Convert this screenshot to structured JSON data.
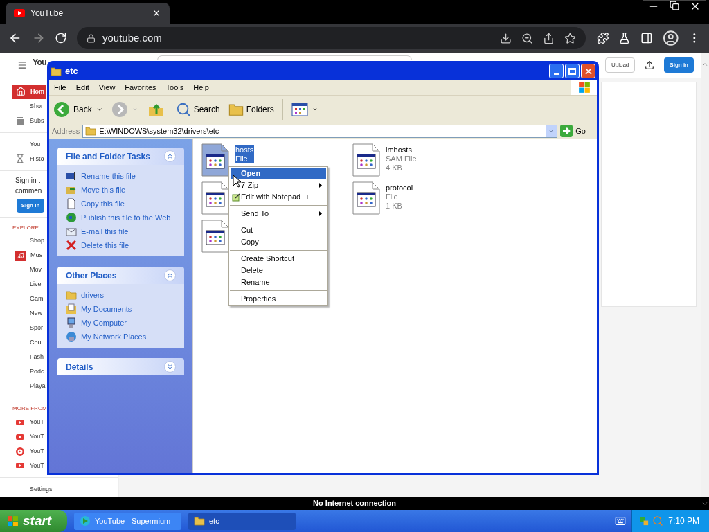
{
  "browser": {
    "tab": {
      "title": "YouTube"
    },
    "address": "youtube.com",
    "forward_disabled": true,
    "status": "No Internet connection"
  },
  "youtube": {
    "logo": "You",
    "upload": "Upload",
    "sign_in": "Sign in",
    "sidebar": [
      {
        "kind": "item",
        "label": "Hom",
        "selected": true
      },
      {
        "kind": "item",
        "label": "Shor",
        "selected": false
      },
      {
        "kind": "item",
        "label": "Subs",
        "selected": false
      },
      {
        "kind": "divider"
      },
      {
        "kind": "item",
        "label": "You",
        "selected": false
      },
      {
        "kind": "item",
        "label": "Histo",
        "selected": false
      },
      {
        "kind": "divider"
      },
      {
        "kind": "prompt",
        "text": "Sign in t\ncommen"
      },
      {
        "kind": "button",
        "label": "Sign in"
      },
      {
        "kind": "divider"
      },
      {
        "kind": "heading",
        "label": "EXPLORE"
      },
      {
        "kind": "item",
        "label": "Shop",
        "selected": false
      },
      {
        "kind": "item",
        "label": "Mus",
        "selected": false
      },
      {
        "kind": "item",
        "label": "Mov",
        "selected": false
      },
      {
        "kind": "item",
        "label": "Live",
        "selected": false
      },
      {
        "kind": "item",
        "label": "Gam",
        "selected": false
      },
      {
        "kind": "item",
        "label": "New",
        "selected": false
      },
      {
        "kind": "item",
        "label": "Spor",
        "selected": false
      },
      {
        "kind": "item",
        "label": "Cou",
        "selected": false
      },
      {
        "kind": "item",
        "label": "Fash",
        "selected": false
      },
      {
        "kind": "item",
        "label": "Podc",
        "selected": false
      },
      {
        "kind": "item",
        "label": "Playa",
        "selected": false
      },
      {
        "kind": "divider"
      },
      {
        "kind": "heading",
        "label": "MORE FROM"
      },
      {
        "kind": "item",
        "label": "YouT",
        "selected": false
      },
      {
        "kind": "item",
        "label": "YouT",
        "selected": false
      },
      {
        "kind": "item",
        "label": "YouT",
        "selected": false
      },
      {
        "kind": "item",
        "label": "YouT",
        "selected": false
      },
      {
        "kind": "divider"
      },
      {
        "kind": "item",
        "label": "Settings",
        "selected": false
      }
    ]
  },
  "explorer": {
    "title": "etc",
    "menu": [
      "File",
      "Edit",
      "View",
      "Favorites",
      "Tools",
      "Help"
    ],
    "toolbar": {
      "back": "Back",
      "search": "Search",
      "folders": "Folders",
      "forward_disabled": true
    },
    "address_label": "Address",
    "address": "E:\\WINDOWS\\system32\\drivers\\etc",
    "go": "Go",
    "panels": [
      {
        "title": "File and Folder Tasks",
        "expanded": true,
        "items": [
          "Rename this file",
          "Move this file",
          "Copy this file",
          "Publish this file to the Web",
          "E-mail this file",
          "Delete this file"
        ]
      },
      {
        "title": "Other Places",
        "expanded": true,
        "items": [
          "drivers",
          "My Documents",
          "My Computer",
          "My Network Places"
        ]
      },
      {
        "title": "Details",
        "expanded": false
      }
    ],
    "files": [
      {
        "name": "hosts",
        "type": "File",
        "selected": true
      },
      {
        "name": "lmhosts",
        "type": "SAM File",
        "size": "4 KB",
        "selected": false
      },
      {
        "selected": false
      },
      {
        "name": "protocol",
        "type": "File",
        "size": "1 KB",
        "selected": false
      },
      {
        "selected": false
      }
    ]
  },
  "context_menu": [
    {
      "kind": "item",
      "label": "Open",
      "default": true,
      "selected": true,
      "submenu": false
    },
    {
      "kind": "item",
      "label": "7-Zip",
      "default": false,
      "selected": false,
      "submenu": true
    },
    {
      "kind": "item",
      "label": "Edit with Notepad++",
      "default": false,
      "selected": false,
      "submenu": false
    },
    {
      "kind": "separator"
    },
    {
      "kind": "item",
      "label": "Send To",
      "default": false,
      "selected": false,
      "submenu": true
    },
    {
      "kind": "separator"
    },
    {
      "kind": "item",
      "label": "Cut",
      "default": false,
      "selected": false,
      "submenu": false
    },
    {
      "kind": "item",
      "label": "Copy",
      "default": false,
      "selected": false,
      "submenu": false
    },
    {
      "kind": "separator"
    },
    {
      "kind": "item",
      "label": "Create Shortcut",
      "default": false,
      "selected": false,
      "submenu": false
    },
    {
      "kind": "item",
      "label": "Delete",
      "default": false,
      "selected": false,
      "submenu": false
    },
    {
      "kind": "item",
      "label": "Rename",
      "default": false,
      "selected": false,
      "submenu": false
    },
    {
      "kind": "separator"
    },
    {
      "kind": "item",
      "label": "Properties",
      "default": false,
      "selected": false,
      "submenu": false
    }
  ],
  "taskbar": {
    "start": "start",
    "tasks": [
      {
        "label": "YouTube - Supermium",
        "selected": false
      },
      {
        "label": "etc",
        "selected": true
      }
    ],
    "clock": "7:10 PM"
  }
}
